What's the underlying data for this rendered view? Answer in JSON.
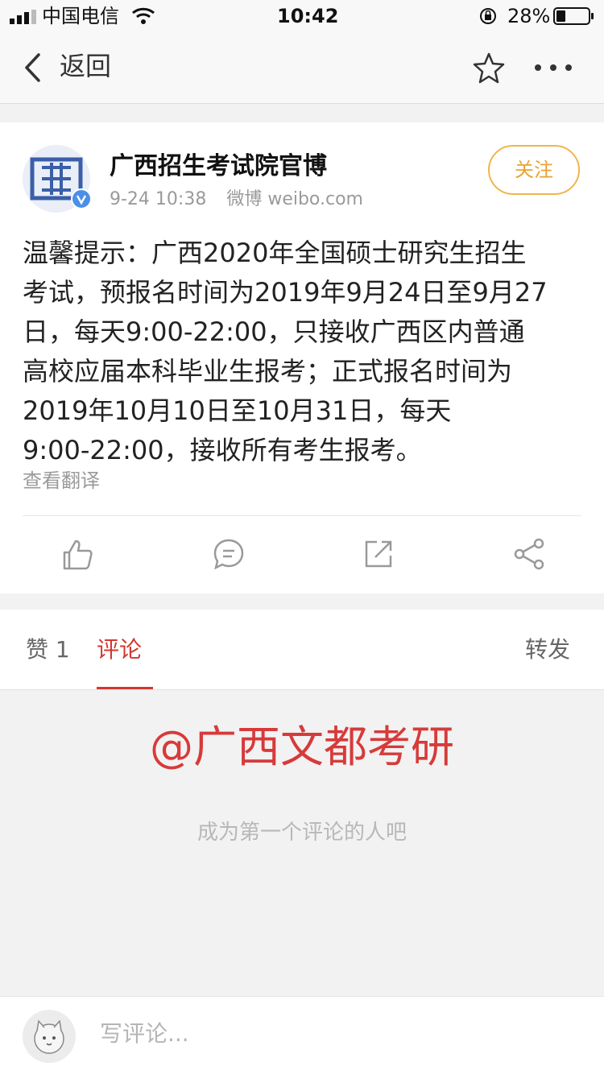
{
  "status_bar": {
    "carrier": "中国电信",
    "time": "10:42",
    "battery": "28%"
  },
  "nav": {
    "back_label": "返回"
  },
  "post": {
    "author": "广西招生考试院官博",
    "date": "9-24 10:38",
    "source": "微博 weibo.com",
    "follow_label": "关注",
    "text": "温馨提示：广西2020年全国硕士研究生招生\n考试，预报名时间为2019年9月24日至9月27\n日，每天9:00-22:00，只接收广西区内普通\n高校应届本科毕业生报考；正式报名时间为\n2019年10月10日至10月31日，每天\n9:00-22:00，接收所有考生报考。",
    "translate_label": "查看翻译"
  },
  "tabs": {
    "likes": "赞 1",
    "comments": "评论",
    "reposts": "转发"
  },
  "comments": {
    "mention": "@广西文都考研",
    "empty_text": "成为第一个评论的人吧"
  },
  "composer": {
    "placeholder": "写评论..."
  },
  "colors": {
    "accent": "#d4372f",
    "follow": "#e9a233",
    "verified": "#4a8fe8"
  }
}
